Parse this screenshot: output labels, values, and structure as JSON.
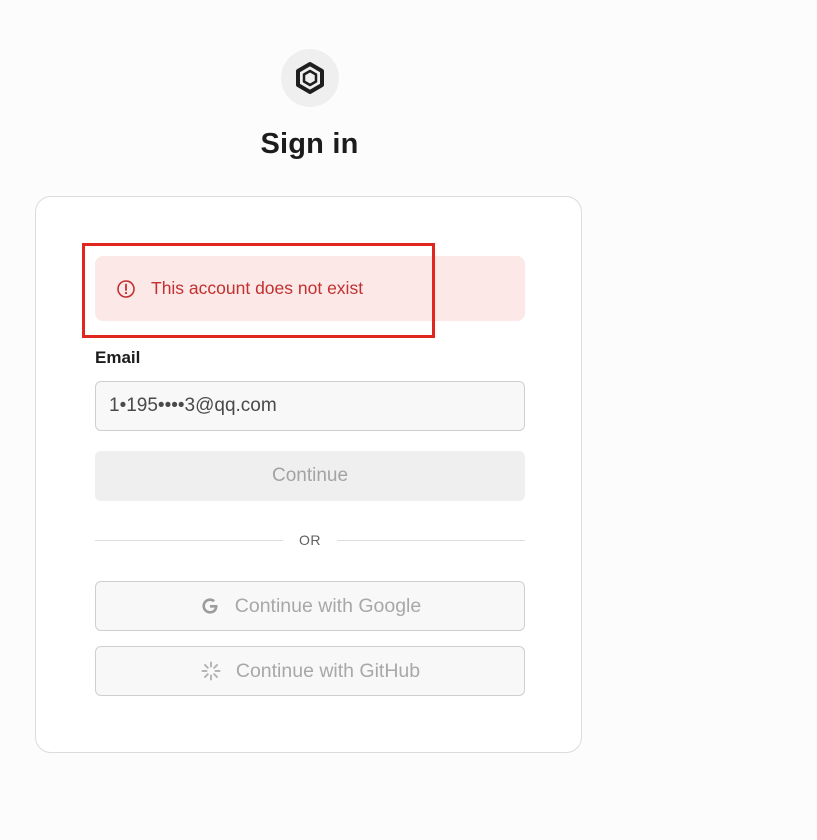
{
  "header": {
    "logo_icon": "hexagon-logo-icon",
    "title": "Sign in"
  },
  "alert": {
    "icon": "exclamation-circle-icon",
    "message": "This account does not exist",
    "color": "#c0312f",
    "background": "#fde8e8"
  },
  "form": {
    "email_label": "Email",
    "email_value": "1•195••••3@qq.com",
    "continue_label": "Continue",
    "divider_text": "OR"
  },
  "oauth": {
    "google": {
      "label": "Continue with Google",
      "icon": "google-icon"
    },
    "github": {
      "label": "Continue with GitHub",
      "icon": "loading-spinner-icon"
    }
  },
  "colors": {
    "highlight_border": "#e0261f",
    "disabled_text": "#a3a3a3"
  }
}
